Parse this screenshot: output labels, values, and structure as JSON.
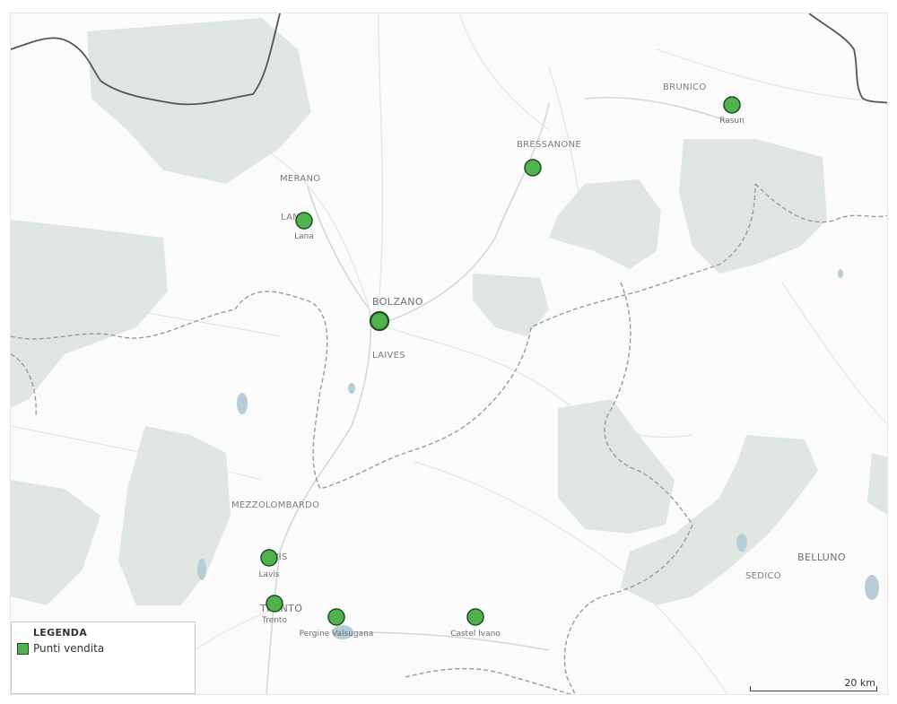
{
  "map": {
    "cities": [
      {
        "key": "merano",
        "name": "MERANO"
      },
      {
        "key": "bolzano",
        "name": "BOLZANO"
      },
      {
        "key": "laives",
        "name": "LAIVES"
      },
      {
        "key": "bressanone",
        "name": "BRESSANONE"
      },
      {
        "key": "brunico",
        "name": "BRUNICO"
      },
      {
        "key": "mezzolombardo",
        "name": "MEZZOLOMBARDO"
      },
      {
        "key": "trento",
        "name": "TRENTO"
      },
      {
        "key": "belluno",
        "name": "BELLUNO"
      },
      {
        "key": "sedico",
        "name": "SEDICO"
      },
      {
        "key": "lavis",
        "name": "LAVIS"
      },
      {
        "key": "lana",
        "name": "LANA"
      }
    ],
    "markers": [
      {
        "key": "rasun",
        "label": "Rasun"
      },
      {
        "key": "bressanone",
        "label": ""
      },
      {
        "key": "lana",
        "label": "Lana"
      },
      {
        "key": "bolzano",
        "label": ""
      },
      {
        "key": "lavis",
        "label": "Lavis"
      },
      {
        "key": "trento",
        "label": "Trento"
      },
      {
        "key": "pergine",
        "label": "Pergine Valsugana"
      },
      {
        "key": "castelivano",
        "label": "Castel Ivano"
      }
    ],
    "marker_color": "#4fb24f"
  },
  "legend": {
    "title": "LEGENDA",
    "item_label": "Punti vendita"
  },
  "scale": {
    "label": "20 km"
  }
}
